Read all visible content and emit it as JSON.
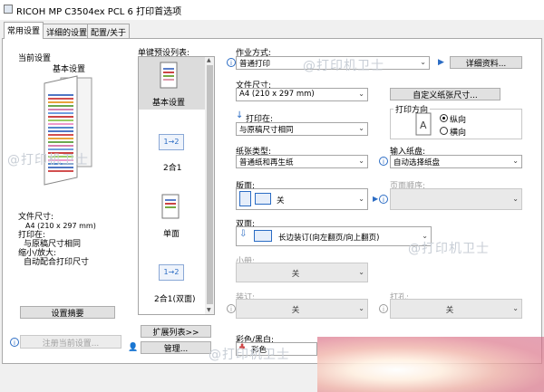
{
  "window": {
    "title": "RICOH MP C3504ex PCL 6 打印首选项"
  },
  "tabs": [
    "常用设置",
    "详细的设置",
    "配置/关于"
  ],
  "current": {
    "heading": "当前设置",
    "preset_name": "基本设置",
    "summary_lines": [
      "文件尺寸:",
      "A4 (210 x 297 mm)",
      "打印在:",
      "与原稿尺寸相同",
      "缩小/放大:",
      "自动配合打印尺寸"
    ],
    "summary_button": "设置摘要",
    "register_button": "注册当前设置..."
  },
  "presets": {
    "heading": "单键预设列表:",
    "items": [
      {
        "label": "基本设置",
        "selected": true
      },
      {
        "label": "2合1",
        "selected": false
      },
      {
        "label": "单面",
        "selected": false
      },
      {
        "label": "2合1(双面)",
        "selected": false
      }
    ],
    "expand_button": "扩展列表>>",
    "manage_button": "管理..."
  },
  "icons": {
    "nup_glyph": "1→2"
  },
  "job": {
    "label": "作业方式:",
    "value": "普通打印",
    "details_button": "详细资料..."
  },
  "paper": {
    "size_label": "文件尺寸:",
    "size_value": "A4 (210 x 297 mm)",
    "custom_button": "自定义纸张尺寸...",
    "print_on_label": "打印在:",
    "print_on_value": "与原稿尺寸相同",
    "orientation_label": "打印方向",
    "orientation_options": [
      "纵向",
      "横向"
    ],
    "orientation_selected": "纵向",
    "type_label": "纸张类型:",
    "type_value": "普通纸和再生纸",
    "tray_label": "输入纸盘:",
    "tray_value": "自动选择纸盘"
  },
  "layout": {
    "pages_label": "版面:",
    "pages_value": "关",
    "order_label": "页面顺序:",
    "order_value": "",
    "duplex_label": "双面:",
    "duplex_value": "长边装订(向左翻页/向上翻页)",
    "booklet_label": "小册:",
    "booklet_value": "关",
    "binding_label": "装订:",
    "binding_value": "关",
    "punch_label": "打孔:",
    "punch_value": "关"
  },
  "color": {
    "label": "彩色/黑白:",
    "value": "彩色"
  },
  "watermark": {
    "text": "@打印机卫士"
  },
  "colors": {
    "accent": "#2b6cc4",
    "panel": "#ffffff",
    "chrome": "#f0f0f0"
  }
}
